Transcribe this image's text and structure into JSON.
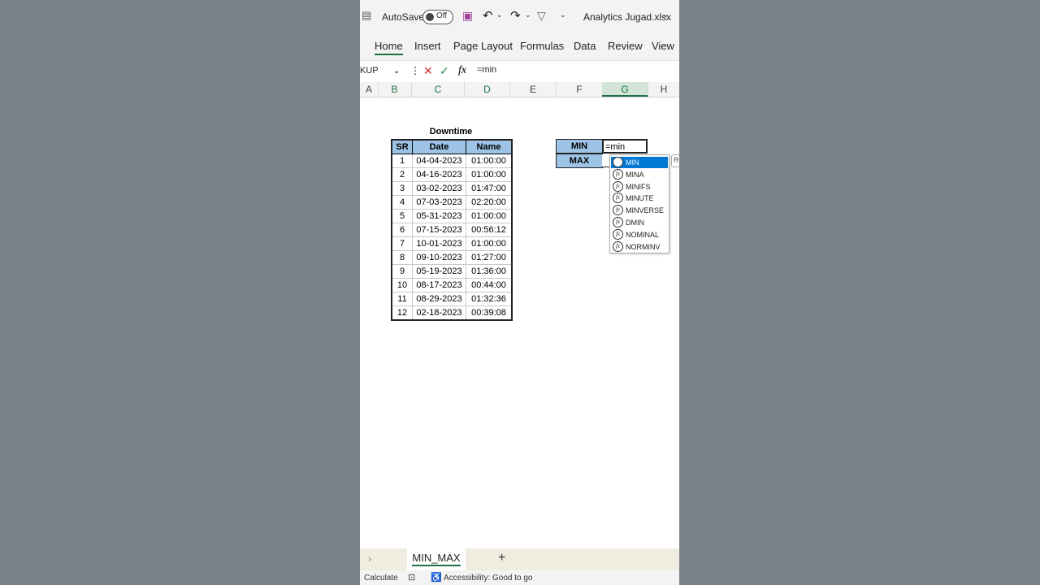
{
  "titlebar": {
    "autosave_label": "AutoSave",
    "autosave_state": "Off",
    "filename": "Analytics Jugad.xlsx"
  },
  "ribbon": {
    "tabs": [
      "Home",
      "Insert",
      "Page Layout",
      "Formulas",
      "Data",
      "Review",
      "View"
    ]
  },
  "formula_bar": {
    "name_box": "KUP",
    "formula": "=min"
  },
  "columns": [
    "A",
    "B",
    "C",
    "D",
    "E",
    "F",
    "G",
    "H"
  ],
  "downtime": {
    "caption": "Downtime",
    "headers": [
      "SR",
      "Date",
      "Name"
    ],
    "rows": [
      [
        "1",
        "04-04-2023",
        "01:00:00"
      ],
      [
        "2",
        "04-16-2023",
        "01:00:00"
      ],
      [
        "3",
        "03-02-2023",
        "01:47:00"
      ],
      [
        "4",
        "07-03-2023",
        "02:20:00"
      ],
      [
        "5",
        "05-31-2023",
        "01:00:00"
      ],
      [
        "6",
        "07-15-2023",
        "00:56:12"
      ],
      [
        "7",
        "10-01-2023",
        "01:00:00"
      ],
      [
        "8",
        "09-10-2023",
        "01:27:00"
      ],
      [
        "9",
        "05-19-2023",
        "01:36:00"
      ],
      [
        "10",
        "08-17-2023",
        "00:44:00"
      ],
      [
        "11",
        "08-29-2023",
        "01:32:36"
      ],
      [
        "12",
        "02-18-2023",
        "00:39:08"
      ]
    ]
  },
  "minmax": {
    "min_label": "MIN",
    "max_label": "MAX",
    "min_value": "=min"
  },
  "autocomplete": {
    "items": [
      "MIN",
      "MINA",
      "MINIFS",
      "MINUTE",
      "MINVERSE",
      "DMIN",
      "NOMINAL",
      "NORMINV"
    ],
    "selected": "MIN",
    "tip": "R"
  },
  "sheets": {
    "active": "MIN_MAX",
    "add": "+"
  },
  "status": {
    "mode": "Calculate",
    "accessibility": "Accessibility: Good to go"
  },
  "colors": {
    "accent": "#1e7145",
    "header_fill": "#9dc3e6",
    "selection": "#0078d4"
  }
}
